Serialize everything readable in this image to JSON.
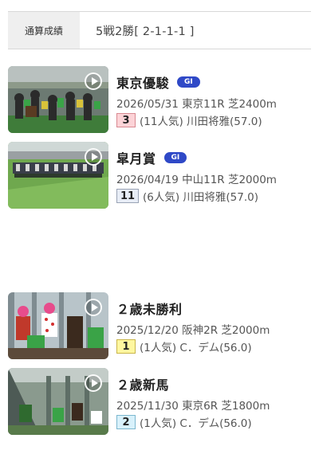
{
  "summary": {
    "label": "通算成績",
    "value": "5戦2勝[ 2-1-1-1 ]"
  },
  "races": [
    {
      "name": "東京優駿",
      "grade": "GI",
      "meta": "2026/05/31 東京11R 芝2400m",
      "rank": "3",
      "rank_class": "r3",
      "jockey": "(11人気) 川田将雅(57.0)",
      "thumb": "crowd-icon"
    },
    {
      "name": "皐月賞",
      "grade": "GI",
      "meta": "2026/04/19 中山11R 芝2000m",
      "rank": "11",
      "rank_class": "rx",
      "jockey": "(6人気) 川田将雅(57.0)",
      "thumb": "turf-icon"
    },
    {
      "name": "２歳未勝利",
      "grade": "",
      "meta": "2025/12/20 阪神2R 芝2000m",
      "rank": "1",
      "rank_class": "r1",
      "jockey": "(1人気) C．デム(56.0)",
      "thumb": "gate-icon"
    },
    {
      "name": "２歳新馬",
      "grade": "",
      "meta": "2025/11/30 東京6R 芝1800m",
      "rank": "2",
      "rank_class": "r2",
      "jockey": "(1人気) C．デム(56.0)",
      "thumb": "gate-icon"
    }
  ]
}
